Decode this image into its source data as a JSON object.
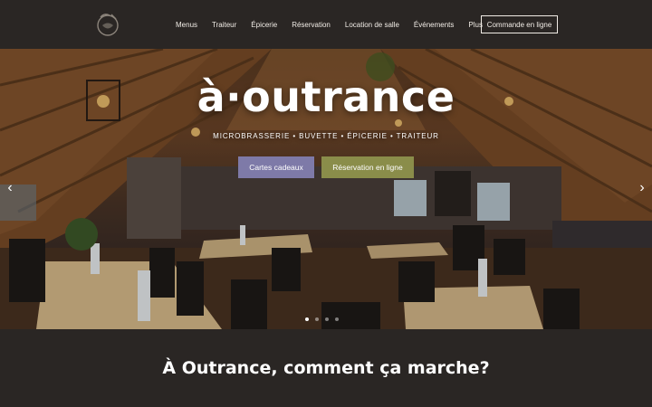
{
  "header": {
    "logo_icon": "kettle-logo-icon",
    "nav": [
      {
        "label": "Menus"
      },
      {
        "label": "Traiteur"
      },
      {
        "label": "Épicerie"
      },
      {
        "label": "Réservation"
      },
      {
        "label": "Location de salle"
      },
      {
        "label": "Événements"
      },
      {
        "label": "Plus"
      }
    ],
    "order_button": "Commande en ligne"
  },
  "hero": {
    "brand": "à·outrance",
    "tagline": "MICROBRASSERIE • BUVETTE • ÉPICERIE • TRAITEUR",
    "cta_primary": "Cartes cadeaux",
    "cta_secondary": "Réservation en ligne",
    "prev_icon": "chevron-left-icon",
    "next_icon": "chevron-right-icon",
    "arrow_left": "‹",
    "arrow_right": "›",
    "slide_count": 4,
    "active_slide": 1,
    "colors": {
      "cta_primary": "#7e7aa8",
      "cta_secondary": "#8a8d4a"
    }
  },
  "section": {
    "title": "À Outrance, comment ça marche?"
  }
}
